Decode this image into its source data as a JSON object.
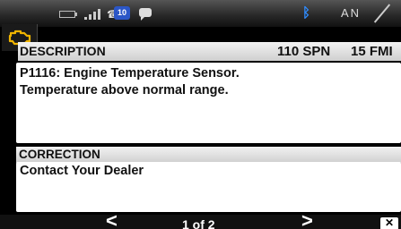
{
  "status_bar": {
    "battery_icon": "battery-icon",
    "signal_icon": "signal-icon",
    "phone_badge": "10",
    "chat_icon": "message-icon",
    "bluetooth_icon": "bluetooth-icon",
    "compass_heading": "AN"
  },
  "check_engine_icon": "check-engine-icon",
  "description": {
    "label": "DESCRIPTION",
    "spn": "110 SPN",
    "fmi": "15 FMI",
    "line1": "P1116: Engine Temperature Sensor.",
    "line2": "Temperature above normal range."
  },
  "correction": {
    "label": "CORRECTION",
    "text": "Contact Your Dealer"
  },
  "pagination": {
    "prev": "<",
    "next": ">",
    "label": "1 of 2",
    "close": "✕"
  },
  "colors": {
    "background": "#000000",
    "panel": "#ffffff",
    "bluetooth": "#2f8cff",
    "phone_badge": "#2b56c7",
    "warning_icon": "#f0b400"
  }
}
